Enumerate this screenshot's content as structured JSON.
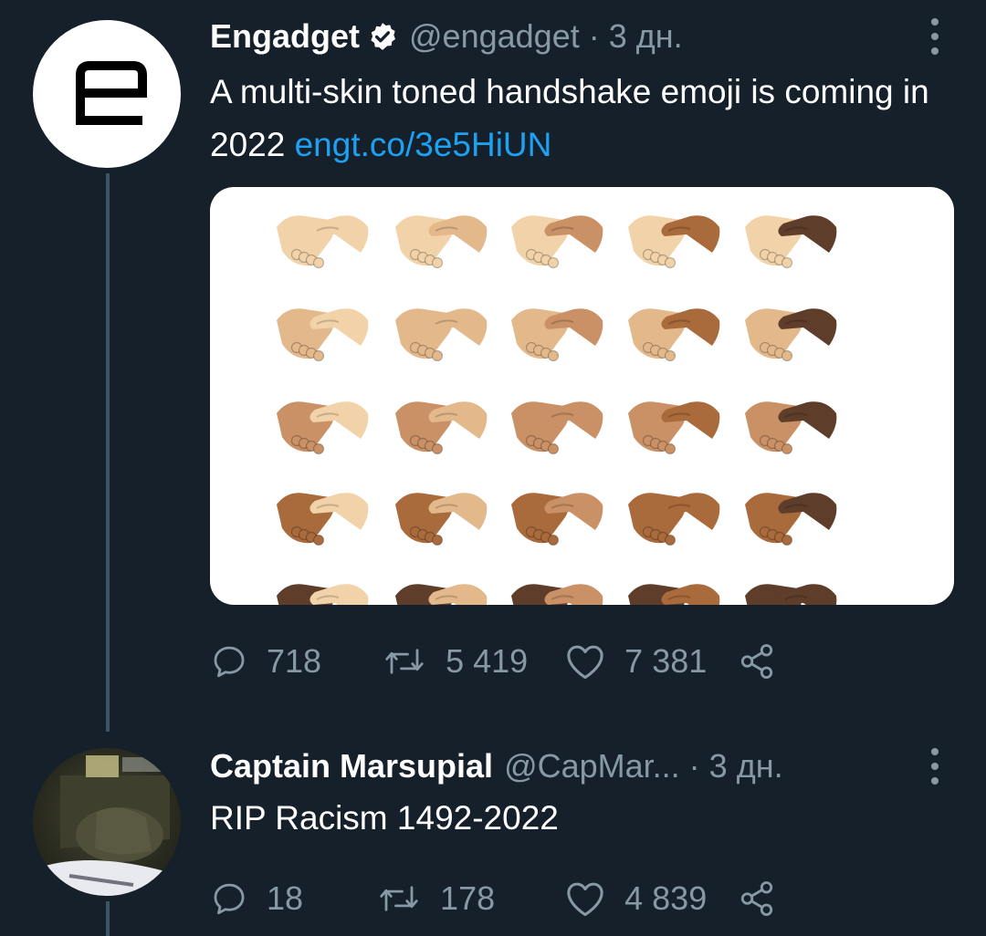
{
  "tweets": [
    {
      "display_name": "Engadget",
      "verified": true,
      "handle": "@engadget",
      "separator": "·",
      "time": "3 дн.",
      "text": "A multi-skin toned handshake emoji is coming in 2022",
      "link": "engt.co/3e5HiUN",
      "avatar": "engadget-logo",
      "media": "handshake-emoji-grid",
      "replies": "718",
      "retweets": "5 419",
      "likes": "7 381"
    },
    {
      "display_name": "Captain Marsupial",
      "handle": "@CapMar...",
      "separator": "·",
      "time": "3 дн.",
      "text": "RIP Racism 1492-2022",
      "avatar": "user-photo",
      "replies": "18",
      "retweets": "178",
      "likes": "4 839"
    }
  ],
  "colors": {
    "background": "#15202b",
    "secondary_text": "#8899a6",
    "link": "#1da1f2",
    "thread_line": "#3d5466"
  },
  "icons": [
    "verified-badge-icon",
    "more-options-icon",
    "reply-icon",
    "retweet-icon",
    "like-icon",
    "share-icon"
  ]
}
